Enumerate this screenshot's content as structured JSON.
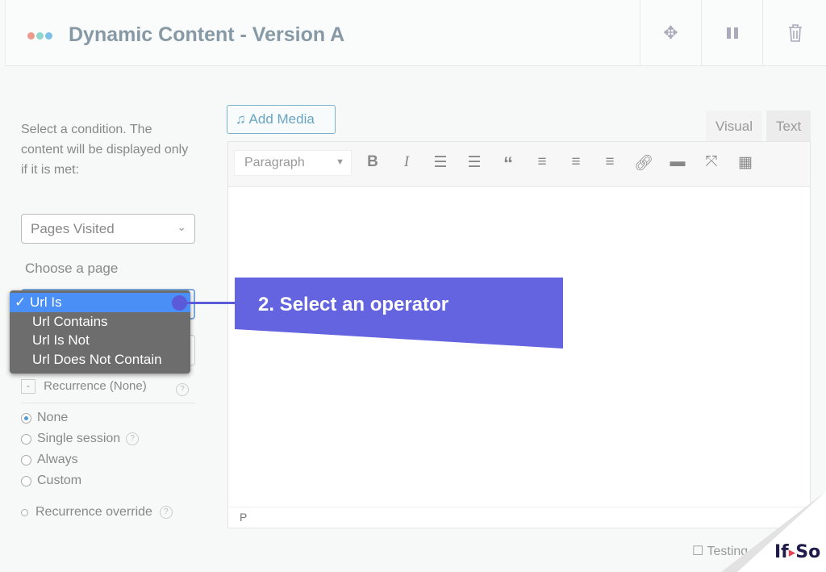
{
  "header": {
    "title": "Dynamic Content - Version A",
    "dot_colors": [
      "#ee9a8a",
      "#8fd6cf",
      "#7dc1e6"
    ],
    "icons": [
      "move-icon",
      "pause-icon",
      "trash-icon"
    ]
  },
  "left": {
    "instructions": "Select a condition. The content will be displayed only if it is met:",
    "condition_select": "Pages Visited",
    "choose_page_label": "Choose a page",
    "operator_options": [
      "Url Is",
      "Url Contains",
      "Url Is Not",
      "Url Does Not Contain"
    ],
    "operator_selected": "Url Is",
    "recurrence_toggle": "-",
    "recurrence_label": "Recurrence (None)",
    "recurrence_options": [
      {
        "label": "None",
        "checked": true
      },
      {
        "label": "Single session",
        "checked": false
      },
      {
        "label": "Always",
        "checked": false
      },
      {
        "label": "Custom",
        "checked": false
      }
    ],
    "recurrence_override": "Recurrence override"
  },
  "editor": {
    "add_media": "Add Media",
    "tabs": [
      "Visual",
      "Text"
    ],
    "active_tab": "Visual",
    "format_select": "Paragraph",
    "status_path": "P"
  },
  "callout": {
    "text": "2. Select an operator",
    "color": "#6464e0"
  },
  "footer": {
    "testing_label": "Testing",
    "logo": "If▸So"
  }
}
